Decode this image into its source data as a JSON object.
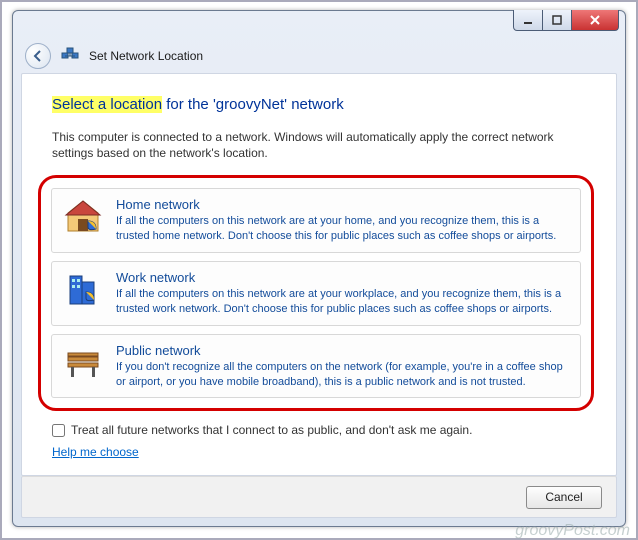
{
  "window": {
    "title": "Set Network Location",
    "buttons": {
      "min_tip": "Minimize",
      "max_tip": "Maximize",
      "close_tip": "Close"
    }
  },
  "heading": {
    "highlight": "Select a location",
    "rest": " for the  'groovyNet'  network"
  },
  "intro": "This computer is connected to a network. Windows will automatically apply the correct network settings based on the network's location.",
  "options": [
    {
      "icon": "home-shield-icon",
      "title": "Home network",
      "desc": "If all the computers on this network are at your home, and you recognize them, this is a trusted home network.  Don't choose this for public places such as coffee shops or airports."
    },
    {
      "icon": "work-shield-icon",
      "title": "Work network",
      "desc": "If all the computers on this network are at your workplace, and you recognize them, this is a trusted work network.  Don't choose this for public places such as coffee shops or airports."
    },
    {
      "icon": "public-bench-icon",
      "title": "Public network",
      "desc": "If you don't recognize all the computers on the network (for example, you're in a coffee shop or airport, or you have mobile broadband), this is a public network and is not trusted."
    }
  ],
  "treat_public_label": "Treat all future networks that I connect to as public, and don't ask me again.",
  "treat_public_checked": false,
  "help_link": "Help me choose",
  "cancel_label": "Cancel",
  "watermark": "groovyPost.com"
}
